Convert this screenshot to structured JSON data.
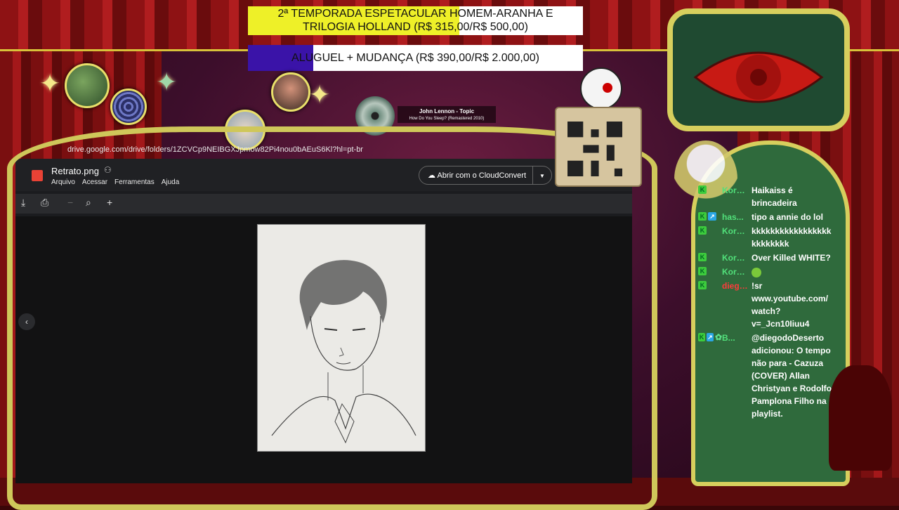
{
  "goals": [
    {
      "line1": "2ª TEMPORADA ESPETACULAR HOMEM-ARANHA E",
      "line2": "TRILOGIA HOLLAND (R$ 315,00/R$ 500,00)",
      "progress": 0.63,
      "color": "#eef028"
    },
    {
      "text": "ALUGUEL + MUDANÇA (R$ 390,00/R$ 2.000,00)",
      "progress": 0.195,
      "color": "#3a13a8"
    }
  ],
  "music": {
    "artist": "John Lennon - Topic",
    "title": "How Do You Sleep? (Remastered 2010)"
  },
  "browser": {
    "url": "drive.google.com/drive/folders/1ZCVCp9NEIBGXJpmow82Pi4nou0bAEuS6Kl?hl=pt-br",
    "file_name": "Retrato.png",
    "menu": [
      "Arquivo",
      "Acessar",
      "Ferramentas",
      "Ajuda"
    ],
    "open_with": "Abrir com o CloudConvert",
    "toolbar_icons": [
      "download-icon",
      "print-icon",
      "zoom-out-icon",
      "zoom-icon",
      "zoom-in-icon"
    ]
  },
  "chat": [
    {
      "user": "Korma...",
      "badges": [
        "k"
      ],
      "text": "Haikaiss é brincadeira",
      "user_color": "#51e07a"
    },
    {
      "user": "has...",
      "badges": [
        "k",
        "blue"
      ],
      "text": "tipo a annie do lol",
      "user_color": "#51e07a"
    },
    {
      "user": "Korma...",
      "badges": [
        "k"
      ],
      "text": "kkkkkkkkkkkkkkkkkkkkkkkkk",
      "user_color": "#51e07a"
    },
    {
      "user": "Korma...",
      "badges": [
        "k"
      ],
      "text": "Over Killed WHITE?",
      "user_color": "#51e07a"
    },
    {
      "user": "Korma...",
      "badges": [
        "k"
      ],
      "text": "",
      "emote": true,
      "user_color": "#51e07a"
    },
    {
      "user": "diegod...",
      "badges": [
        "k"
      ],
      "text": "!sr www.youtube.com/watch?v=_Jcn10Iiuu4",
      "user_color": "#ff3b3b"
    },
    {
      "user": "B...",
      "badges": [
        "k",
        "blue",
        "gear"
      ],
      "text": "@diegodoDeserto adicionou: O tempo não para - Cazuza (COVER) Allan Christyan e Rodolfo Pamplona Filho na playlist.",
      "user_color": "#51e07a"
    }
  ]
}
